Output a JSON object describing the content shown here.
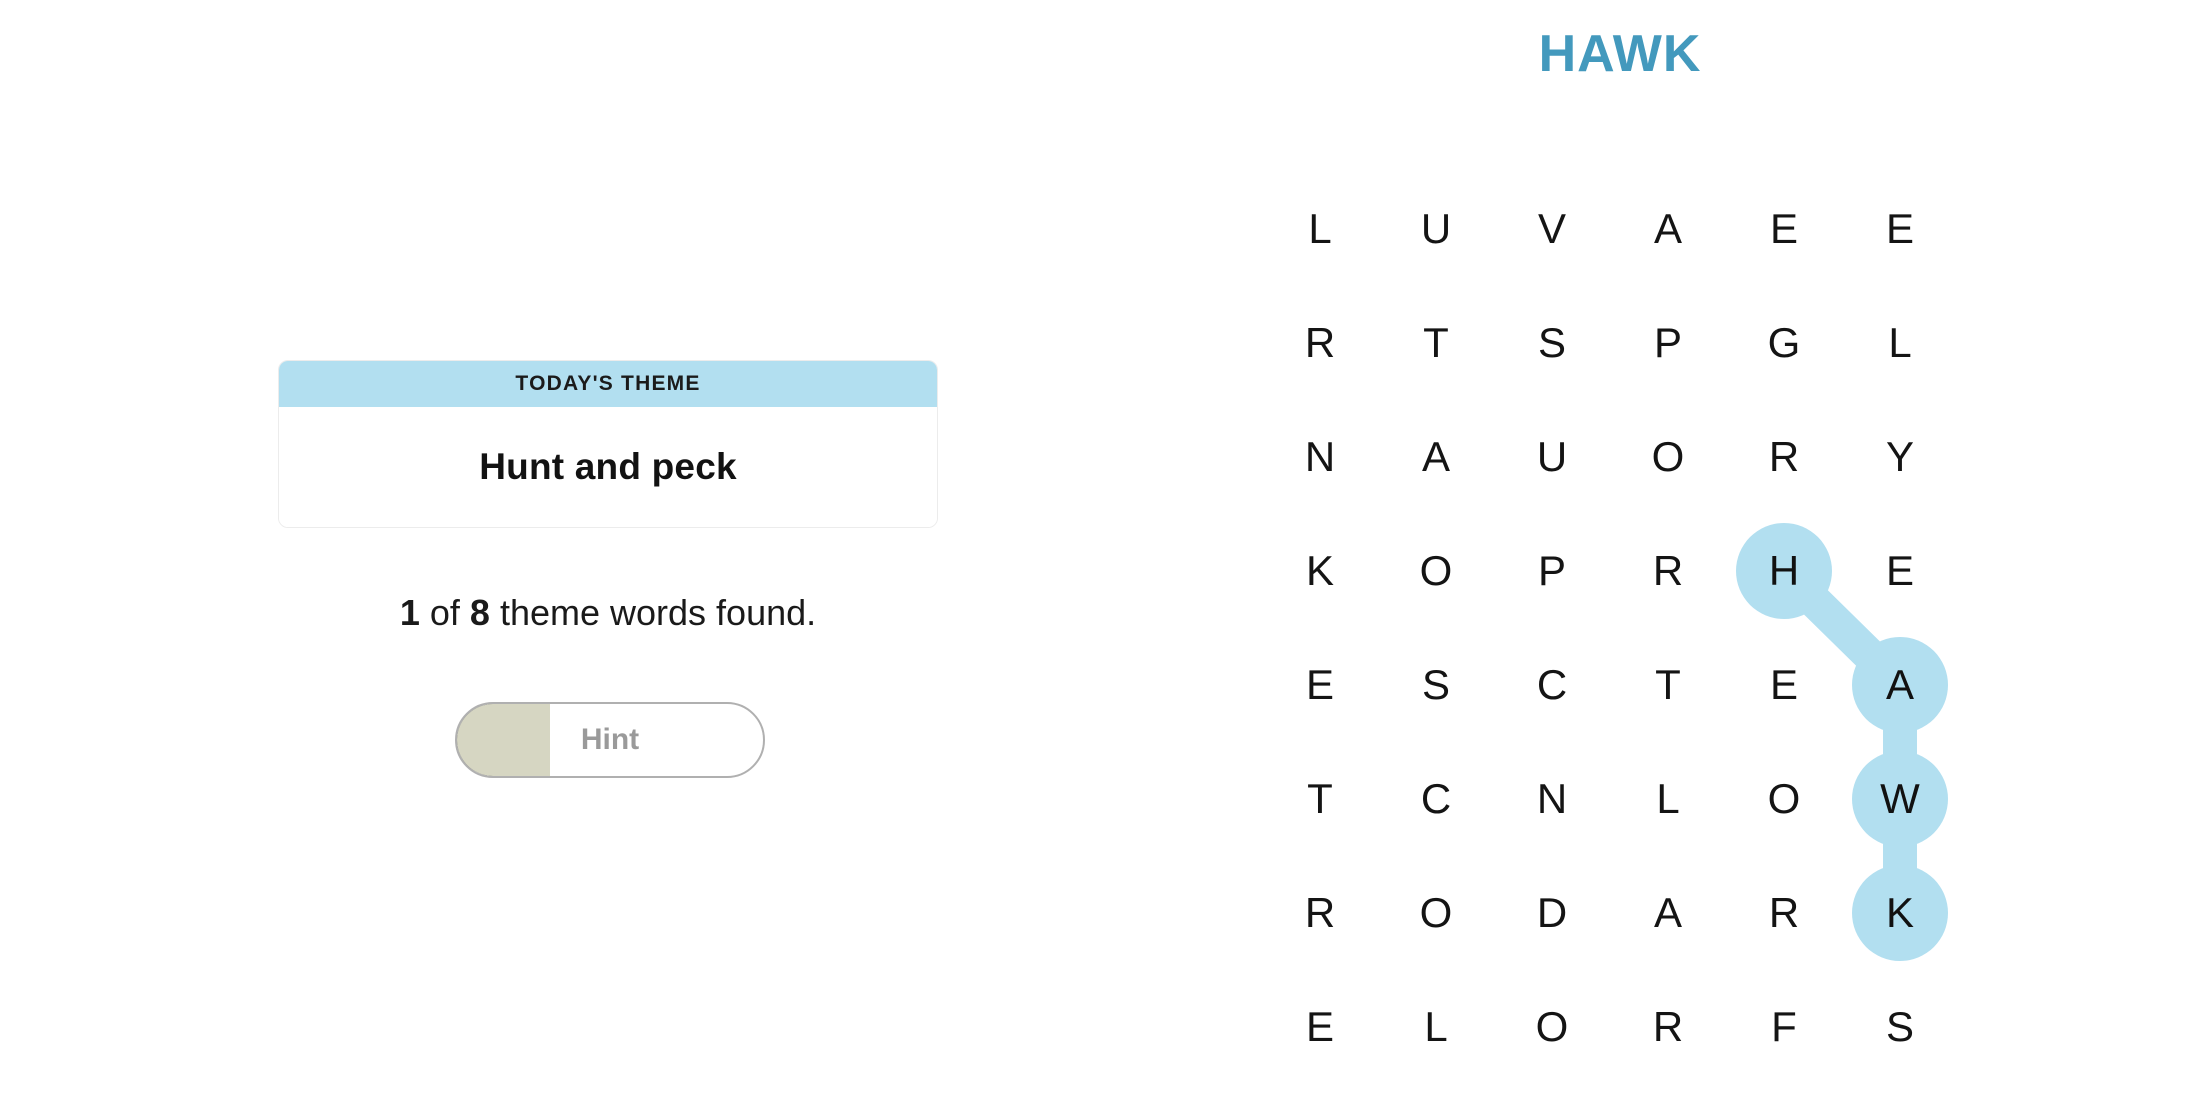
{
  "found_word": {
    "text": "HAWK",
    "color": "#4399bd"
  },
  "theme_card": {
    "header": "TODAY'S THEME",
    "phrase": "Hunt and peck",
    "header_bg": "#b2dff0"
  },
  "progress": {
    "found_count": "1",
    "of_label": "of",
    "total_count": "8",
    "suffix": "theme words found.",
    "full_text": "1 of 8 theme words found."
  },
  "hint_button": {
    "label": "Hint",
    "fill_percent": 31,
    "fill_color": "#d6d6c2"
  },
  "grid": {
    "rows": 8,
    "cols": 6,
    "letters": [
      [
        "L",
        "U",
        "V",
        "A",
        "E",
        "E"
      ],
      [
        "R",
        "T",
        "S",
        "P",
        "G",
        "L"
      ],
      [
        "N",
        "A",
        "U",
        "O",
        "R",
        "Y"
      ],
      [
        "K",
        "O",
        "P",
        "R",
        "H",
        "E"
      ],
      [
        "E",
        "S",
        "C",
        "T",
        "E",
        "A"
      ],
      [
        "T",
        "C",
        "N",
        "L",
        "O",
        "W"
      ],
      [
        "R",
        "O",
        "D",
        "A",
        "R",
        "K"
      ],
      [
        "E",
        "L",
        "O",
        "R",
        "F",
        "S"
      ]
    ],
    "selection": {
      "word": "HAWK",
      "highlight_color": "#b2dff0",
      "path": [
        {
          "row": 3,
          "col": 4,
          "letter": "H"
        },
        {
          "row": 4,
          "col": 5,
          "letter": "A"
        },
        {
          "row": 5,
          "col": 5,
          "letter": "W"
        },
        {
          "row": 6,
          "col": 5,
          "letter": "K"
        }
      ]
    }
  }
}
